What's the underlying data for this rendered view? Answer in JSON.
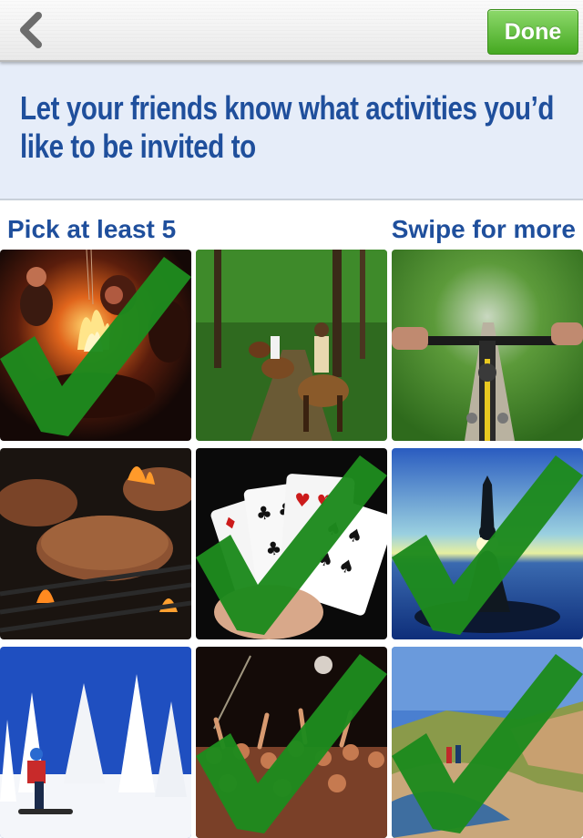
{
  "nav": {
    "back_icon": "chevron-left-icon",
    "done_label": "Done",
    "done_color": "#4caf25"
  },
  "banner": {
    "text": "Let your friends know what activities you’d like to be invited to",
    "text_color": "#1f4f9c",
    "background": "#e6edf9"
  },
  "captions": {
    "left": "Pick at least 5",
    "right": "Swipe for more"
  },
  "check_color": "#1e8a1e",
  "activities": [
    {
      "name": "campfire",
      "selected": true
    },
    {
      "name": "horseback-riding",
      "selected": false
    },
    {
      "name": "mountain-biking",
      "selected": false
    },
    {
      "name": "grilling",
      "selected": false
    },
    {
      "name": "playing-cards",
      "selected": true
    },
    {
      "name": "yoga",
      "selected": true
    },
    {
      "name": "snowboarding",
      "selected": false
    },
    {
      "name": "concert",
      "selected": true
    },
    {
      "name": "beach-hiking",
      "selected": true
    }
  ]
}
